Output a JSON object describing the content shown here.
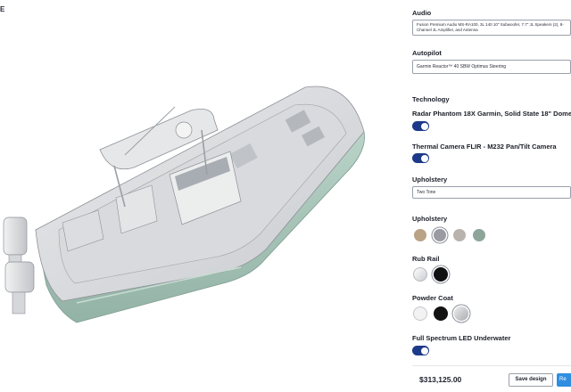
{
  "brand": {
    "logo_text": "E"
  },
  "audio": {
    "label": "Audio",
    "value": "Fusion Premium Audio MS-RA100, 3L 140 10\" Subwoofer, 7.7\" JL Speakers (2), 8-Channel JL Amplifier, and Antenna"
  },
  "autopilot": {
    "label": "Autopilot",
    "value": "Garmin Reactor™ 40 SBW Optimus Steering"
  },
  "technology": {
    "label": "Technology",
    "items": [
      {
        "label": "Radar Phantom 18X Garmin, Solid State 18\" Dome",
        "enabled": true
      },
      {
        "label": "Thermal Camera FLIR - M232 Pan/Tilt Camera",
        "enabled": true
      }
    ]
  },
  "upholstery_select": {
    "label": "Upholstery",
    "value": "Two Tone"
  },
  "upholstery_colors": {
    "label": "Upholstery",
    "swatches": [
      {
        "name": "tan",
        "color": "#b9a285",
        "selected": false
      },
      {
        "name": "grey",
        "color": "#9a9aa2",
        "selected": true
      },
      {
        "name": "stone",
        "color": "#b8b3ac",
        "selected": false
      },
      {
        "name": "sage",
        "color": "#8ea59b",
        "selected": false
      }
    ]
  },
  "rub_rail": {
    "label": "Rub Rail",
    "swatches": [
      {
        "name": "white",
        "color": "#e9eaec",
        "selected": false
      },
      {
        "name": "black",
        "color": "#111111",
        "selected": true
      }
    ]
  },
  "powder_coat": {
    "label": "Powder Coat",
    "swatches": [
      {
        "name": "white",
        "color": "#f2f2f2",
        "selected": false
      },
      {
        "name": "black",
        "color": "#121212",
        "selected": false
      },
      {
        "name": "silver",
        "color": "#c6c6c8",
        "selected": true
      }
    ]
  },
  "underwater_led": {
    "label": "Full Spectrum LED Underwater",
    "enabled": true
  },
  "footer": {
    "price": "$313,125.00",
    "save_label": "Save design",
    "primary_label": "Re"
  },
  "colors": {
    "accent": "#1d3a8a",
    "primary_button": "#2e8fe0",
    "hull": "#a9c7bb"
  }
}
